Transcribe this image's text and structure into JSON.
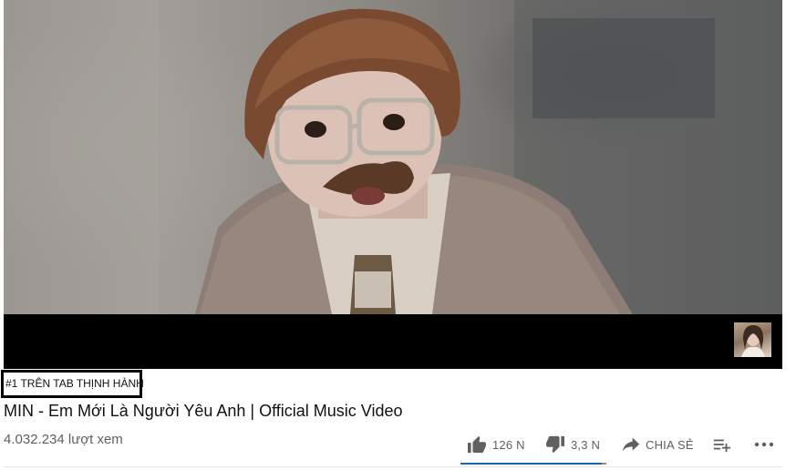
{
  "video": {
    "trending_badge": "#1 TRÊN TAB THỊNH HÀNH",
    "title": "MIN - Em Mới Là Người Yêu Anh | Official Music Video",
    "views": "4.032.234 lượt xem"
  },
  "actions": {
    "like_count": "126 N",
    "dislike_count": "3,3 N",
    "share_label": "CHIA SẺ"
  },
  "sentiment_bar": {
    "like_fraction": 0.97
  },
  "colors": {
    "sentiment_like": "#1c62b9",
    "sentiment_dislike": "#909090",
    "text_primary": "#111111",
    "text_secondary": "#606060"
  },
  "icons": [
    "thumb-up-icon",
    "thumb-down-icon",
    "share-icon",
    "add-to-playlist-icon",
    "more-icon"
  ]
}
